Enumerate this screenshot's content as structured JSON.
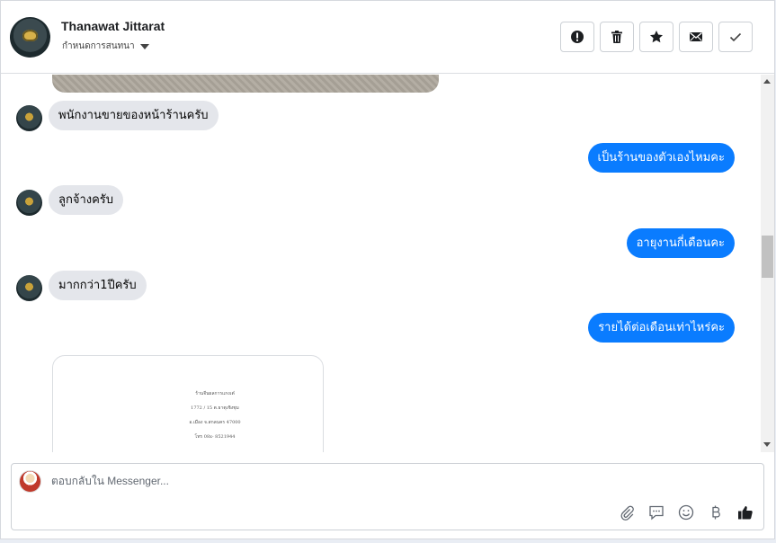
{
  "header": {
    "contact_name": "Thanawat Jittarat",
    "subtitle": "กำหนดการสนทนา",
    "actions": [
      {
        "name": "report-button",
        "icon": "alert-icon"
      },
      {
        "name": "delete-button",
        "icon": "trash-icon"
      },
      {
        "name": "star-button",
        "icon": "star-icon"
      },
      {
        "name": "mark-unread-button",
        "icon": "envelope-icon"
      },
      {
        "name": "done-button",
        "icon": "check-icon"
      }
    ]
  },
  "messages": [
    {
      "from": "them",
      "text": "พนักงานขายของหน้าร้านครับ"
    },
    {
      "from": "me",
      "text": "เป็นร้านของตัวเองไหมคะ"
    },
    {
      "from": "them",
      "text": "ลูกจ้างครับ"
    },
    {
      "from": "me",
      "text": "อายุงานกี่เดือนคะ"
    },
    {
      "from": "them",
      "text": "มากกว่า1ปีครับ"
    },
    {
      "from": "me",
      "text": "รายได้ต่อเดือนเท่าไหร่คะ"
    }
  ],
  "document": {
    "lines": [
      "ร้านจีนผลการแกงเต๋",
      "1772 / 15 ต.ธาตุเชิงชุม",
      "อ.เมือง จ.สกลนคร 47000",
      "โทร 08x- 8521944"
    ]
  },
  "composer": {
    "placeholder": "ตอบกลับใน Messenger..."
  },
  "colors": {
    "outgoing_bubble": "#0a7cff",
    "incoming_bubble": "#e4e6eb"
  }
}
